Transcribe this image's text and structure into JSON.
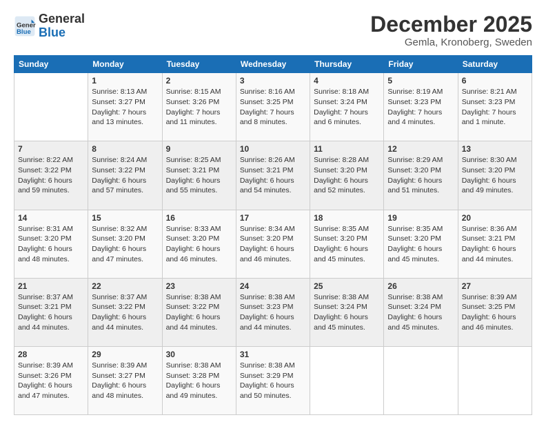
{
  "header": {
    "logo_general": "General",
    "logo_blue": "Blue",
    "month_title": "December 2025",
    "location": "Gemla, Kronoberg, Sweden"
  },
  "days_of_week": [
    "Sunday",
    "Monday",
    "Tuesday",
    "Wednesday",
    "Thursday",
    "Friday",
    "Saturday"
  ],
  "weeks": [
    [
      {
        "day": "",
        "info": ""
      },
      {
        "day": "1",
        "info": "Sunrise: 8:13 AM\nSunset: 3:27 PM\nDaylight: 7 hours\nand 13 minutes."
      },
      {
        "day": "2",
        "info": "Sunrise: 8:15 AM\nSunset: 3:26 PM\nDaylight: 7 hours\nand 11 minutes."
      },
      {
        "day": "3",
        "info": "Sunrise: 8:16 AM\nSunset: 3:25 PM\nDaylight: 7 hours\nand 8 minutes."
      },
      {
        "day": "4",
        "info": "Sunrise: 8:18 AM\nSunset: 3:24 PM\nDaylight: 7 hours\nand 6 minutes."
      },
      {
        "day": "5",
        "info": "Sunrise: 8:19 AM\nSunset: 3:23 PM\nDaylight: 7 hours\nand 4 minutes."
      },
      {
        "day": "6",
        "info": "Sunrise: 8:21 AM\nSunset: 3:23 PM\nDaylight: 7 hours\nand 1 minute."
      }
    ],
    [
      {
        "day": "7",
        "info": "Sunrise: 8:22 AM\nSunset: 3:22 PM\nDaylight: 6 hours\nand 59 minutes."
      },
      {
        "day": "8",
        "info": "Sunrise: 8:24 AM\nSunset: 3:22 PM\nDaylight: 6 hours\nand 57 minutes."
      },
      {
        "day": "9",
        "info": "Sunrise: 8:25 AM\nSunset: 3:21 PM\nDaylight: 6 hours\nand 55 minutes."
      },
      {
        "day": "10",
        "info": "Sunrise: 8:26 AM\nSunset: 3:21 PM\nDaylight: 6 hours\nand 54 minutes."
      },
      {
        "day": "11",
        "info": "Sunrise: 8:28 AM\nSunset: 3:20 PM\nDaylight: 6 hours\nand 52 minutes."
      },
      {
        "day": "12",
        "info": "Sunrise: 8:29 AM\nSunset: 3:20 PM\nDaylight: 6 hours\nand 51 minutes."
      },
      {
        "day": "13",
        "info": "Sunrise: 8:30 AM\nSunset: 3:20 PM\nDaylight: 6 hours\nand 49 minutes."
      }
    ],
    [
      {
        "day": "14",
        "info": "Sunrise: 8:31 AM\nSunset: 3:20 PM\nDaylight: 6 hours\nand 48 minutes."
      },
      {
        "day": "15",
        "info": "Sunrise: 8:32 AM\nSunset: 3:20 PM\nDaylight: 6 hours\nand 47 minutes."
      },
      {
        "day": "16",
        "info": "Sunrise: 8:33 AM\nSunset: 3:20 PM\nDaylight: 6 hours\nand 46 minutes."
      },
      {
        "day": "17",
        "info": "Sunrise: 8:34 AM\nSunset: 3:20 PM\nDaylight: 6 hours\nand 46 minutes."
      },
      {
        "day": "18",
        "info": "Sunrise: 8:35 AM\nSunset: 3:20 PM\nDaylight: 6 hours\nand 45 minutes."
      },
      {
        "day": "19",
        "info": "Sunrise: 8:35 AM\nSunset: 3:20 PM\nDaylight: 6 hours\nand 45 minutes."
      },
      {
        "day": "20",
        "info": "Sunrise: 8:36 AM\nSunset: 3:21 PM\nDaylight: 6 hours\nand 44 minutes."
      }
    ],
    [
      {
        "day": "21",
        "info": "Sunrise: 8:37 AM\nSunset: 3:21 PM\nDaylight: 6 hours\nand 44 minutes."
      },
      {
        "day": "22",
        "info": "Sunrise: 8:37 AM\nSunset: 3:22 PM\nDaylight: 6 hours\nand 44 minutes."
      },
      {
        "day": "23",
        "info": "Sunrise: 8:38 AM\nSunset: 3:22 PM\nDaylight: 6 hours\nand 44 minutes."
      },
      {
        "day": "24",
        "info": "Sunrise: 8:38 AM\nSunset: 3:23 PM\nDaylight: 6 hours\nand 44 minutes."
      },
      {
        "day": "25",
        "info": "Sunrise: 8:38 AM\nSunset: 3:24 PM\nDaylight: 6 hours\nand 45 minutes."
      },
      {
        "day": "26",
        "info": "Sunrise: 8:38 AM\nSunset: 3:24 PM\nDaylight: 6 hours\nand 45 minutes."
      },
      {
        "day": "27",
        "info": "Sunrise: 8:39 AM\nSunset: 3:25 PM\nDaylight: 6 hours\nand 46 minutes."
      }
    ],
    [
      {
        "day": "28",
        "info": "Sunrise: 8:39 AM\nSunset: 3:26 PM\nDaylight: 6 hours\nand 47 minutes."
      },
      {
        "day": "29",
        "info": "Sunrise: 8:39 AM\nSunset: 3:27 PM\nDaylight: 6 hours\nand 48 minutes."
      },
      {
        "day": "30",
        "info": "Sunrise: 8:38 AM\nSunset: 3:28 PM\nDaylight: 6 hours\nand 49 minutes."
      },
      {
        "day": "31",
        "info": "Sunrise: 8:38 AM\nSunset: 3:29 PM\nDaylight: 6 hours\nand 50 minutes."
      },
      {
        "day": "",
        "info": ""
      },
      {
        "day": "",
        "info": ""
      },
      {
        "day": "",
        "info": ""
      }
    ]
  ]
}
